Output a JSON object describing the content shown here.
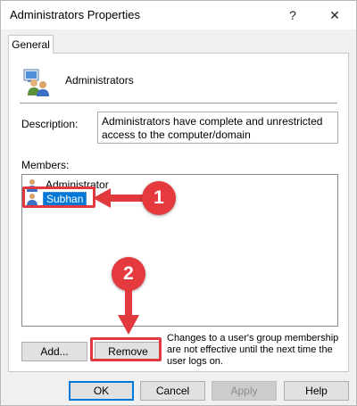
{
  "window": {
    "title": "Administrators Properties",
    "help_glyph": "?",
    "close_glyph": "✕"
  },
  "tabs": [
    {
      "label": "General"
    }
  ],
  "group": {
    "name": "Administrators",
    "description_label": "Description:",
    "description_value": "Administrators have complete and unrestricted access to the computer/domain"
  },
  "members": {
    "label": "Members:",
    "items": [
      {
        "name": "Administrator",
        "selected": false
      },
      {
        "name": "Subhan",
        "selected": true
      }
    ]
  },
  "actions": {
    "add_label": "Add...",
    "remove_label": "Remove",
    "note": "Changes to a user's group membership are not effective until the next time the user logs on."
  },
  "footer": {
    "ok_label": "OK",
    "cancel_label": "Cancel",
    "apply_label": "Apply",
    "help_label": "Help"
  },
  "annotations": {
    "step1": "1",
    "step2": "2",
    "highlight_color": "#e2393e"
  }
}
